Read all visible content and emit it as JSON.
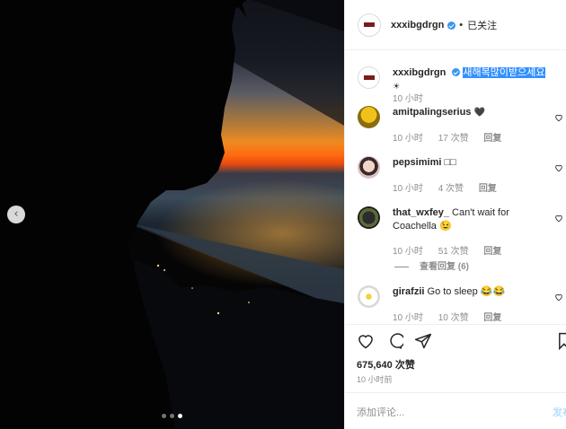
{
  "header": {
    "username": "xxxibgdrgn",
    "separator": "•",
    "follow_status": "已关注"
  },
  "caption": {
    "username": "xxxibgdrgn",
    "text": "새해복많이받으세요",
    "emoji": "☀",
    "time": "10 小时"
  },
  "comments": [
    {
      "username": "amitpalingserius",
      "text": "🖤",
      "time": "10 小时",
      "likes": "17 次赞",
      "reply": "回复"
    },
    {
      "username": "pepsimimi",
      "text": "□□",
      "time": "10 小时",
      "likes": "4 次赞",
      "reply": "回复"
    },
    {
      "username": "that_wxfey_",
      "text": "Can't wait for Coachella 😉",
      "time": "10 小时",
      "likes": "51 次赞",
      "reply": "回复",
      "view_replies": "查看回复 (6)"
    },
    {
      "username": "girafzii",
      "text": "Go to sleep 😂😂",
      "time": "10 小时",
      "likes": "10 次赞",
      "reply": "回复"
    }
  ],
  "post": {
    "likes": "675,640 次赞",
    "time": "10 小时前"
  },
  "comment_box": {
    "placeholder": "添加评论...",
    "post_label": "发布"
  },
  "carousel": {
    "count": 3,
    "active": 2
  },
  "colors": {
    "accent": "#3897f0",
    "highlight": "#3390ff"
  }
}
